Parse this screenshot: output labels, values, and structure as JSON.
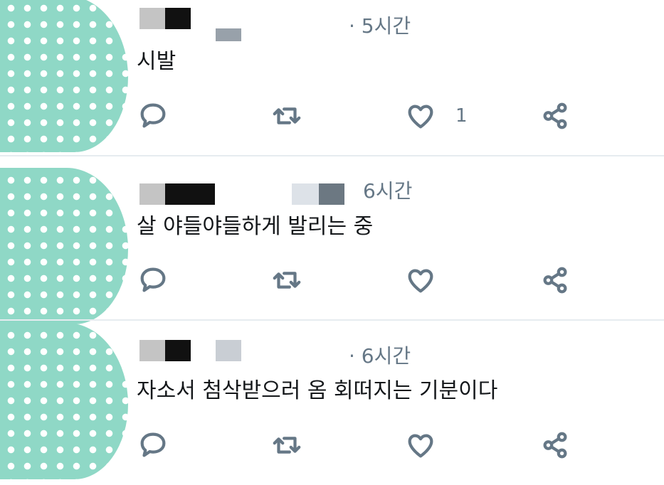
{
  "colors": {
    "text": "#14171a",
    "secondary": "#657786",
    "divider": "#e6ecf0",
    "avatar": "#8fd8c6"
  },
  "tweets": [
    {
      "time": "· 5시간",
      "text": "시발",
      "like_count": "1"
    },
    {
      "time": "6시간",
      "text": "살 야들야들하게 발리는 중",
      "like_count": ""
    },
    {
      "time": "· 6시간",
      "text": "자소서 첨삭받으러 옴 회떠지는 기분이다",
      "like_count": ""
    }
  ],
  "icons": {
    "reply": "speech-bubble-icon",
    "retweet": "retweet-icon",
    "like": "heart-icon",
    "share": "share-icon"
  }
}
